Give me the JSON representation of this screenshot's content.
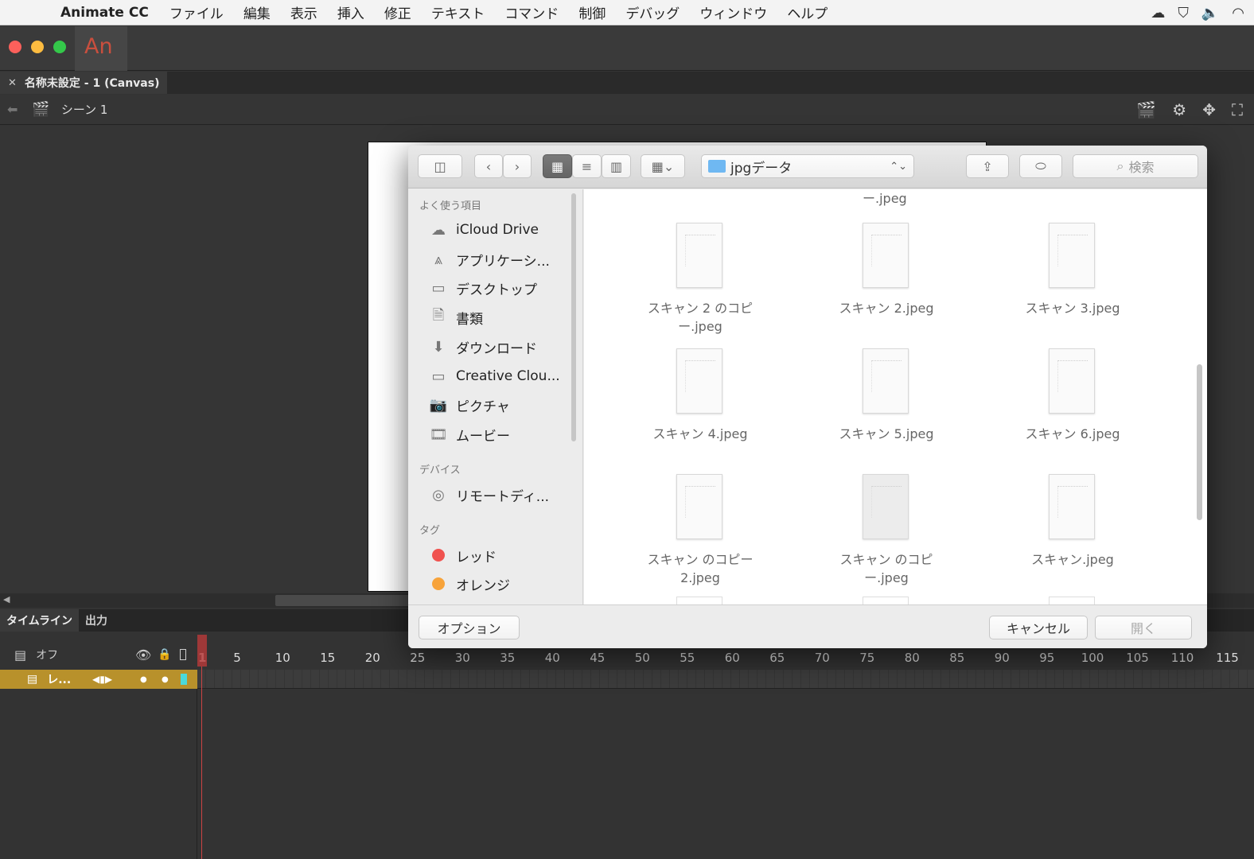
{
  "menubar": {
    "app_name": "Animate CC",
    "items": [
      "ファイル",
      "編集",
      "表示",
      "挿入",
      "修正",
      "テキスト",
      "コマンド",
      "制御",
      "デバッグ",
      "ウィンドウ",
      "ヘルプ"
    ]
  },
  "app": {
    "logo": "An"
  },
  "document": {
    "tab_title": "名称未設定 - 1 (Canvas)"
  },
  "scene": {
    "label": "シーン 1"
  },
  "timeline": {
    "tabs": [
      "タイムライン",
      "出力"
    ],
    "layer_header_label": "オフ",
    "layer_name": "レ...",
    "current_frame": "1",
    "ruler": [
      "5",
      "10",
      "15",
      "20",
      "25",
      "30",
      "35",
      "40",
      "45",
      "50",
      "55",
      "60",
      "65",
      "70",
      "75",
      "80",
      "85",
      "90",
      "95",
      "100",
      "105",
      "110",
      "115"
    ]
  },
  "dialog": {
    "path": "jpgデータ",
    "search_placeholder": "検索",
    "sidebar": {
      "favorites_heading": "よく使う項目",
      "favorites": [
        {
          "label": "iCloud Drive",
          "icon": "cloud-icon"
        },
        {
          "label": "アプリケーシ...",
          "icon": "applications-icon"
        },
        {
          "label": "デスクトップ",
          "icon": "desktop-icon"
        },
        {
          "label": "書類",
          "icon": "documents-icon"
        },
        {
          "label": "ダウンロード",
          "icon": "download-icon"
        },
        {
          "label": "Creative Clou...",
          "icon": "folder-icon"
        },
        {
          "label": "ピクチャ",
          "icon": "camera-icon"
        },
        {
          "label": "ムービー",
          "icon": "film-icon"
        }
      ],
      "devices_heading": "デバイス",
      "devices": [
        {
          "label": "リモートディ...",
          "icon": "disc-icon"
        }
      ],
      "tags_heading": "タグ",
      "tags": [
        {
          "label": "レッド",
          "color": "#f0524f"
        },
        {
          "label": "オレンジ",
          "color": "#f7a33a"
        }
      ]
    },
    "files_top_label": "ー.jpeg",
    "files": [
      {
        "line1": "スキャン 2 のコピ",
        "line2": "ー.jpeg"
      },
      {
        "line1": "スキャン 2.jpeg",
        "line2": ""
      },
      {
        "line1": "スキャン 3.jpeg",
        "line2": ""
      },
      {
        "line1": "スキャン 4.jpeg",
        "line2": ""
      },
      {
        "line1": "スキャン 5.jpeg",
        "line2": ""
      },
      {
        "line1": "スキャン 6.jpeg",
        "line2": ""
      },
      {
        "line1": "スキャン のコピー",
        "line2": "2.jpeg"
      },
      {
        "line1": "スキャン のコピ",
        "line2": "ー.jpeg"
      },
      {
        "line1": "スキャン.jpeg",
        "line2": ""
      }
    ],
    "buttons": {
      "options": "オプション",
      "cancel": "キャンセル",
      "open": "開く"
    }
  }
}
